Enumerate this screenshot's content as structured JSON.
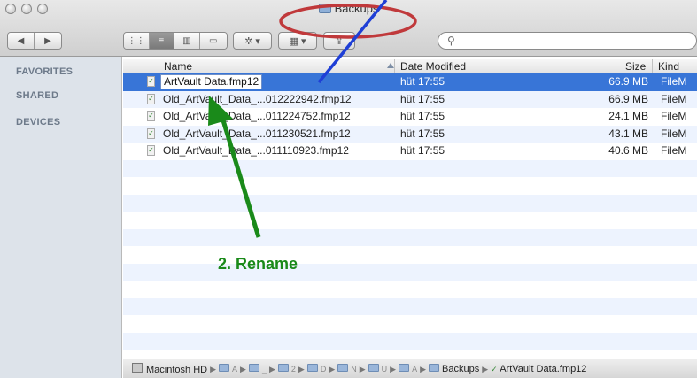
{
  "window": {
    "title": "Backups"
  },
  "toolbar": {
    "back_label": "◀",
    "forward_label": "▶",
    "view_icon": "⋮⋮",
    "view_list": "≡",
    "view_columns": "▥",
    "view_coverflow": "▭",
    "action_label": "✲ ▾",
    "arrange_label": "▦ ▾",
    "share_label": "⇪",
    "search_placeholder": ""
  },
  "sidebar": {
    "sections": [
      "FAVORITES",
      "SHARED",
      "DEVICES"
    ]
  },
  "columns": {
    "name": "Name",
    "date": "Date Modified",
    "size": "Size",
    "kind": "Kind"
  },
  "files": [
    {
      "name": "ArtVault Data.fmp12",
      "date": "hüt 17:55",
      "size": "66.9 MB",
      "kind": "FileM",
      "selected": true
    },
    {
      "name": "Old_ArtVault_Data_...012222942.fmp12",
      "date": "hüt 17:55",
      "size": "66.9 MB",
      "kind": "FileM"
    },
    {
      "name": "Old_ArtVault_Data_...011224752.fmp12",
      "date": "hüt 17:55",
      "size": "24.1 MB",
      "kind": "FileM"
    },
    {
      "name": "Old_ArtVault_Data_...011230521.fmp12",
      "date": "hüt 17:55",
      "size": "43.1 MB",
      "kind": "FileM"
    },
    {
      "name": "Old_ArtVault_Data_...011110923.fmp12",
      "date": "hüt 17:55",
      "size": "40.6 MB",
      "kind": "FileM"
    }
  ],
  "pathbar": {
    "disk": "Macintosh HD",
    "folders": [
      "A",
      "_",
      "2",
      "D",
      "N",
      "U",
      "A"
    ],
    "current_folder": "Backups",
    "file": "ArtVault Data.fmp12"
  },
  "annotation": {
    "label": "2. Rename",
    "arrow_color": "#1a8a1a",
    "ellipse_color": "#c0393b",
    "line_color": "#1f3fd6"
  },
  "colors": {
    "selection": "#3875d7",
    "stripe": "#edf3fe",
    "sidebar": "#dde3ea"
  }
}
